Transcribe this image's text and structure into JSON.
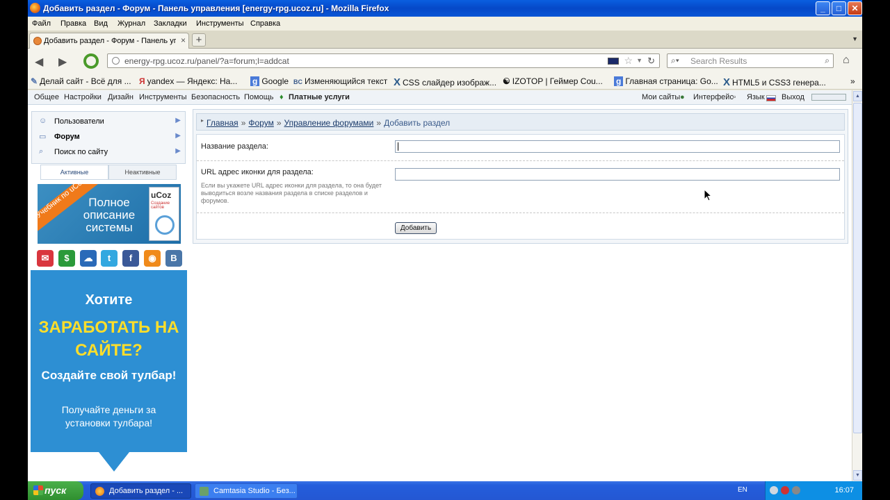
{
  "window": {
    "title": "Добавить раздел - Форум - Панель управления [energy-rpg.ucoz.ru] - Mozilla Firefox",
    "buttons": {
      "minimize": "_",
      "maximize": "□",
      "close": "✕"
    }
  },
  "menu": [
    "Файл",
    "Правка",
    "Вид",
    "Журнал",
    "Закладки",
    "Инструменты",
    "Справка"
  ],
  "tab": {
    "label": "Добавить раздел - Форум - Панель уп...",
    "close": "×",
    "new": "+"
  },
  "nav": {
    "back": "◀",
    "forward": "▶",
    "url": "energy-rpg.ucoz.ru/panel/?a=forum;l=addcat",
    "search_placeholder": "Search Results",
    "home": "⌂"
  },
  "bookmarks": [
    {
      "icon": "✎",
      "label": "Делай сайт - Всё для ..."
    },
    {
      "icon": "Я",
      "label": "yandex — Яндекс: На..."
    },
    {
      "icon": "g",
      "label": "Google"
    },
    {
      "icon": "BC",
      "label": "Изменяющийся текст"
    },
    {
      "icon": "X",
      "label": "CSS слайдер изображ..."
    },
    {
      "icon": "☯",
      "label": "IZOTOP | Геймер Cou..."
    },
    {
      "icon": "g",
      "label": "Главная страница: Go..."
    },
    {
      "icon": "X",
      "label": "HTML5 и CSS3 генера..."
    }
  ],
  "bookmarks_more": "»",
  "cp_top": {
    "left": [
      "Общее",
      "Настройки",
      "Дизайн",
      "Инструменты",
      "Безопасность",
      "Помощь"
    ],
    "paid": "Платные услуги",
    "right": [
      "Мои сайты",
      "Интерфейс",
      "Язык",
      "Выход"
    ]
  },
  "sidebar": {
    "items": [
      {
        "label": "Пользователи",
        "icon": "user-icon"
      },
      {
        "label": "Форум",
        "icon": "forum-icon"
      },
      {
        "label": "Поиск по сайту",
        "icon": "search-icon"
      }
    ],
    "tabs": {
      "active": "Активные",
      "inactive": "Неактивные"
    }
  },
  "promo": {
    "ribbon": "Учебник по uCoz",
    "text": "Полное описание системы",
    "brand": "uCoz",
    "brand_sub": "Создание сайтов"
  },
  "social": [
    {
      "icon": "mail-icon",
      "glyph": "✉",
      "color": "#d9363e"
    },
    {
      "icon": "money-icon",
      "glyph": "$",
      "color": "#2a9a3a"
    },
    {
      "icon": "cloud-icon",
      "glyph": "☁",
      "color": "#2a6ab8"
    },
    {
      "icon": "twitter-icon",
      "glyph": "t",
      "color": "#33a8e0"
    },
    {
      "icon": "facebook-icon",
      "glyph": "f",
      "color": "#3b5998"
    },
    {
      "icon": "rss-icon",
      "glyph": "◉",
      "color": "#f08a1a"
    },
    {
      "icon": "vk-icon",
      "glyph": "В",
      "color": "#4a76a8"
    }
  ],
  "banner": {
    "line1": "Хотите",
    "line2": "ЗАРАБОТАТЬ НА САЙТЕ?",
    "line3": "Создайте свой тулбар!",
    "line4": "Получайте деньги за установки тулбара!"
  },
  "breadcrumb": {
    "links": [
      "Главная",
      "Форум",
      "Управление форумами"
    ],
    "current": "Добавить раздел",
    "separator": "»"
  },
  "form": {
    "name_label": "Название раздела:",
    "name_value": "",
    "icon_label": "URL адрес иконки для раздела:",
    "icon_hint": "Если вы укажете URL адрес иконки для раздела, то она будет выводиться возле названия раздела в списке разделов и форумов.",
    "icon_value": "",
    "submit": "Добавить"
  },
  "taskbar": {
    "start": "пуск",
    "items": [
      "Добавить раздел - ...",
      "Camtasia Studio - Без..."
    ],
    "lang": "EN",
    "time": "16:07"
  }
}
